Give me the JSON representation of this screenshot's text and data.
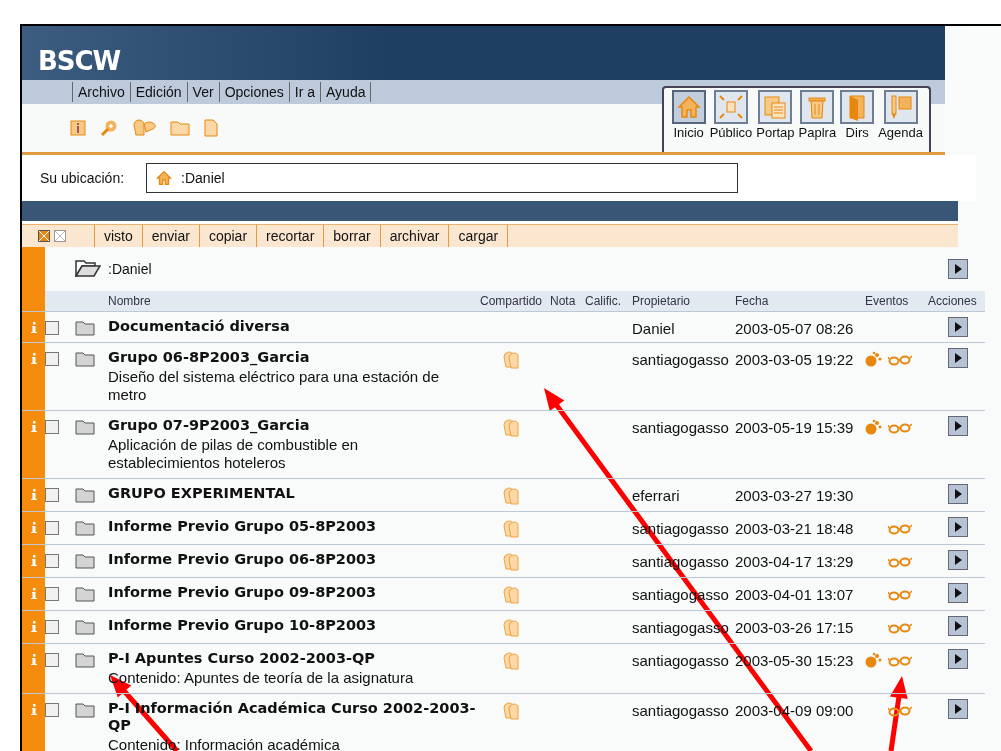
{
  "header": {
    "logo": "BSCW"
  },
  "menu": [
    "Archivo",
    "Edición",
    "Ver",
    "Opciones",
    "Ir a",
    "Ayuda"
  ],
  "nav": [
    {
      "kind": "home",
      "label": "Inicio",
      "selected": true
    },
    {
      "kind": "public",
      "label": "Público",
      "selected": false
    },
    {
      "kind": "clipboard",
      "label": "Portap",
      "selected": false
    },
    {
      "kind": "trash",
      "label": "Paplra",
      "selected": false
    },
    {
      "kind": "dirs",
      "label": "Dirs",
      "selected": false
    },
    {
      "kind": "calendar",
      "label": "Agenda",
      "selected": false
    }
  ],
  "location": {
    "label": "Su ubicación:",
    "value": ":Daniel"
  },
  "actions": [
    "visto",
    "enviar",
    "copiar",
    "recortar",
    "borrar",
    "archivar",
    "cargar"
  ],
  "folder": {
    "name": ":Daniel"
  },
  "columns": [
    "Nombre",
    "Compartido",
    "Nota",
    "Calific.",
    "Propietario",
    "Fecha",
    "Eventos",
    "Acciones"
  ],
  "rows": [
    {
      "name": "Documentació diversa",
      "checked": false,
      "shared": false,
      "owner": "Daniel",
      "date": "2003-05-07 08:26",
      "new_event": false,
      "read_event": false
    },
    {
      "name": "Grupo 06-8P2003_Garcia",
      "description": "Diseño del sistema eléctrico para una estación de metro",
      "checked": false,
      "shared": true,
      "owner": "santiagogasso",
      "date": "2003-03-05 19:22",
      "new_event": true,
      "read_event": true
    },
    {
      "name": "Grupo 07-9P2003_Garcia",
      "description": "Aplicación de pilas de combustible en establecimientos hoteleros",
      "checked": false,
      "shared": true,
      "owner": "santiagogasso",
      "date": "2003-05-19 15:39",
      "new_event": true,
      "read_event": true
    },
    {
      "name": "GRUPO EXPERIMENTAL",
      "checked": false,
      "shared": true,
      "owner": "eferrari",
      "date": "2003-03-27 19:30",
      "new_event": false,
      "read_event": false
    },
    {
      "name": "Informe Previo Grupo 05-8P2003",
      "checked": false,
      "shared": true,
      "owner": "santiagogasso",
      "date": "2003-03-21 18:48",
      "new_event": false,
      "read_event": true
    },
    {
      "name": "Informe Previo Grupo 06-8P2003",
      "checked": false,
      "shared": true,
      "owner": "santiagogasso",
      "date": "2003-04-17 13:29",
      "new_event": false,
      "read_event": true
    },
    {
      "name": "Informe Previo Grupo 09-8P2003",
      "checked": false,
      "shared": true,
      "owner": "santiagogasso",
      "date": "2003-04-01 13:07",
      "new_event": false,
      "read_event": true
    },
    {
      "name": "Informe Previo Grupo 10-8P2003",
      "checked": false,
      "shared": true,
      "owner": "santiagogasso",
      "date": "2003-03-26 17:15",
      "new_event": false,
      "read_event": true
    },
    {
      "name": "P-I Apuntes Curso 2002-2003-QP",
      "description": "Contenido: Apuntes de teoría de la asignatura",
      "checked": false,
      "shared": true,
      "owner": "santiagogasso",
      "date": "2003-05-30 15:23",
      "new_event": true,
      "read_event": true
    },
    {
      "name": "P-I Información Académica Curso 2002-2003-QP",
      "description": "Contenido: Información académica",
      "checked": false,
      "shared": true,
      "owner": "santiagogasso",
      "date": "2003-04-09 09:00",
      "new_event": false,
      "read_event": true
    }
  ]
}
